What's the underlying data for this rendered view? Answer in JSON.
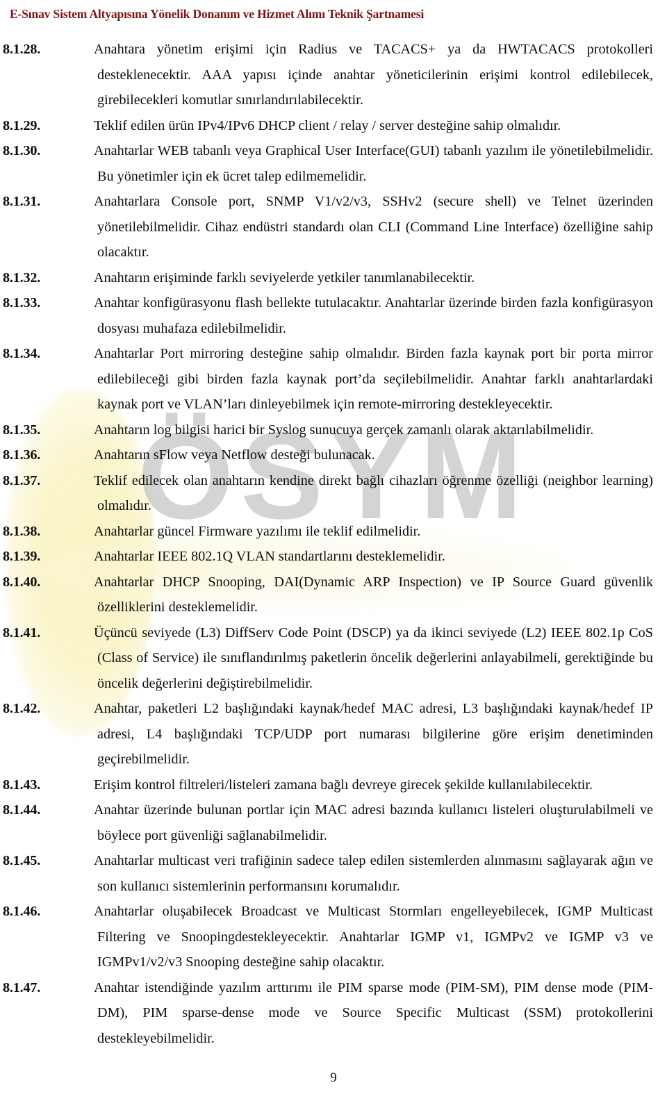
{
  "document": {
    "header_title": "E-Sınav Sistem Altyapısına Yönelik Donanım ve Hizmet Alımı Teknik Şartnamesi",
    "header_color": "#7b1416",
    "watermark_text": "ÖSYM",
    "watermark_color": "#989898",
    "page_number": "9",
    "highlight_color": "#faf4c8"
  },
  "clauses": [
    {
      "number": "8.1.28.",
      "text": "Anahtara yönetim erişimi için Radius ve TACACS+ ya da HWTACACS protokolleri desteklenecektir. AAA yapısı içinde anahtar yöneticilerinin erişimi kontrol edilebilecek, girebilecekleri komutlar sınırlandırılabilecektir."
    },
    {
      "number": "8.1.29.",
      "text": "Teklif edilen ürün IPv4/IPv6 DHCP client / relay / server desteğine sahip olmalıdır."
    },
    {
      "number": "8.1.30.",
      "text": "Anahtarlar WEB tabanlı veya Graphical User Interface(GUI) tabanlı yazılım ile yönetilebilmelidir. Bu yönetimler için ek ücret talep edilmemelidir."
    },
    {
      "number": "8.1.31.",
      "text": "Anahtarlara Console port, SNMP V1/v2/v3, SSHv2 (secure shell) ve Telnet üzerinden yönetilebilmelidir. Cihaz endüstri standardı olan CLI (Command Line Interface) özelliğine sahip olacaktır."
    },
    {
      "number": "8.1.32.",
      "text": "Anahtarın erişiminde farklı seviyelerde yetkiler tanımlanabilecektir."
    },
    {
      "number": "8.1.33.",
      "text": "Anahtar konfigürasyonu flash bellekte tutulacaktır. Anahtarlar üzerinde birden fazla konfigürasyon dosyası muhafaza edilebilmelidir."
    },
    {
      "number": "8.1.34.",
      "text": "Anahtarlar Port mirroring desteğine sahip olmalıdır. Birden fazla kaynak port bir porta mirror edilebileceği gibi birden fazla kaynak port’da seçilebilmelidir. Anahtar farklı anahtarlardaki kaynak port ve VLAN’ları dinleyebilmek için remote-mirroring destekleyecektir."
    },
    {
      "number": "8.1.35.",
      "text": "Anahtarın log bilgisi harici bir Syslog sunucuya gerçek zamanlı olarak aktarılabilmelidir."
    },
    {
      "number": "8.1.36.",
      "text": "Anahtarın sFlow veya Netflow desteği bulunacak."
    },
    {
      "number": "8.1.37.",
      "text": "Teklif edilecek olan anahtarın kendine direkt bağlı cihazları öğrenme özelliği (neighbor learning) olmalıdır."
    },
    {
      "number": "8.1.38.",
      "text": "Anahtarlar güncel Firmware yazılımı ile teklif edilmelidir."
    },
    {
      "number": "8.1.39.",
      "text": "Anahtarlar IEEE 802.1Q VLAN standartlarını desteklemelidir."
    },
    {
      "number": "8.1.40.",
      "text": "Anahtarlar DHCP Snooping, DAI(Dynamic ARP Inspection) ve IP Source Guard güvenlik özelliklerini desteklemelidir."
    },
    {
      "number": "8.1.41.",
      "text": "Üçüncü seviyede (L3) DiffServ Code Point (DSCP) ya da ikinci seviyede (L2) IEEE 802.1p CoS (Class of Service) ile sınıflandırılmış paketlerin öncelik değerlerini anlayabilmeli, gerektiğinde bu öncelik değerlerini değiştirebilmelidir."
    },
    {
      "number": "8.1.42.",
      "text": "Anahtar, paketleri L2 başlığındaki kaynak/hedef MAC adresi, L3 başlığındaki kaynak/hedef IP adresi, L4 başlığındaki TCP/UDP port numarası bilgilerine göre erişim denetiminden geçirebilmelidir."
    },
    {
      "number": "8.1.43.",
      "text": "Erişim kontrol filtreleri/listeleri zamana bağlı devreye girecek şekilde kullanılabilecektir."
    },
    {
      "number": "8.1.44.",
      "text": "Anahtar üzerinde bulunan portlar için MAC adresi bazında kullanıcı listeleri oluşturulabilmeli ve böylece port güvenliği sağlanabilmelidir."
    },
    {
      "number": "8.1.45.",
      "text": "Anahtarlar multicast veri trafiğinin sadece talep edilen sistemlerden alınmasını sağlayarak ağın ve son kullanıcı sistemlerinin performansını korumalıdır."
    },
    {
      "number": "8.1.46.",
      "text": "Anahtarlar oluşabilecek Broadcast ve Multicast Stormları engelleyebilecek, IGMP Multicast Filtering ve Snoopingdestekleyecektir. Anahtarlar IGMP v1, IGMPv2 ve IGMP v3 ve IGMPv1/v2/v3 Snooping desteğine sahip olacaktır."
    },
    {
      "number": "8.1.47.",
      "text": "Anahtar istendiğinde yazılım arttırımı ile PIM sparse mode (PIM-SM), PIM dense mode (PIM-DM), PIM sparse-dense mode ve Source Specific Multicast (SSM) protokollerini destekleyebilmelidir."
    }
  ]
}
